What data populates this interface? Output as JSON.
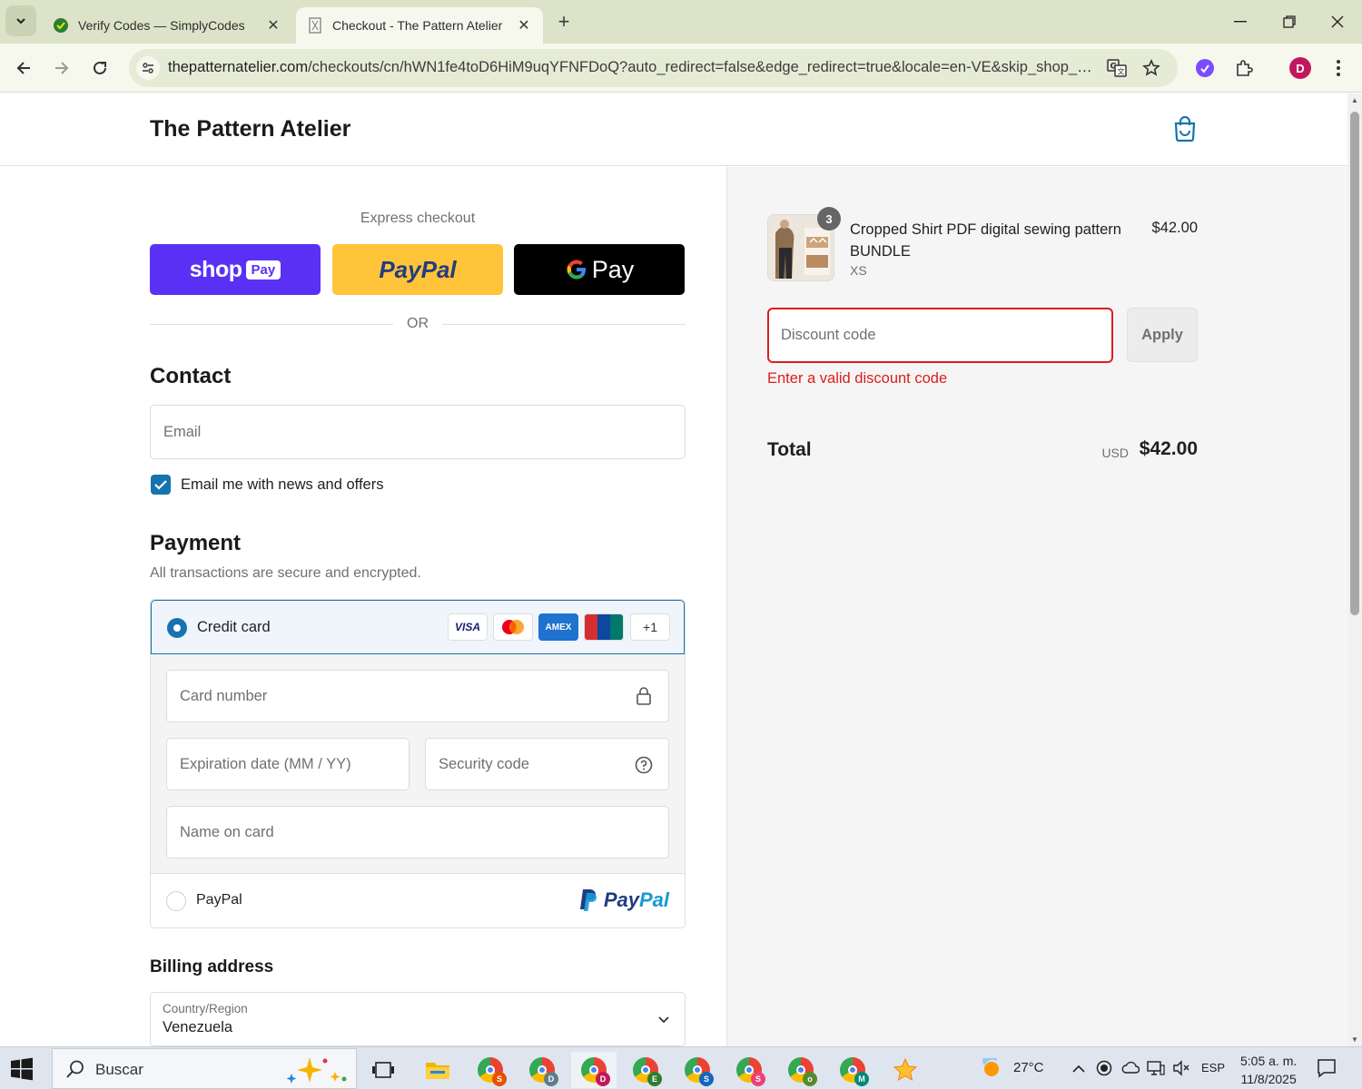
{
  "browser": {
    "tabs": [
      {
        "title": "Verify Codes — SimplyCodes",
        "active": false
      },
      {
        "title": "Checkout - The Pattern Atelier",
        "active": true
      }
    ],
    "url_host": "thepatternatelier.com",
    "url_path": "/checkouts/cn/hWN1fe4toD6HiM9uqYFNFDoQ?auto_redirect=false&edge_redirect=true&locale=en-VE&skip_shop_p...",
    "profile_initial": "D",
    "icons": [
      "back-icon",
      "forward-icon",
      "reload-icon",
      "site-settings-icon",
      "translate-icon",
      "star-icon",
      "extension-icon",
      "puzzle-icon",
      "menu-dots-icon"
    ]
  },
  "store": {
    "name": "The Pattern Atelier"
  },
  "checkout": {
    "express_title": "Express checkout",
    "shop_pay": {
      "word": "shop",
      "badge": "Pay"
    },
    "paypal_label": "PayPal",
    "gpay_label": "Pay",
    "or": "OR",
    "contact_title": "Contact",
    "email_placeholder": "Email",
    "newsletter_label": "Email me with news and offers",
    "newsletter_checked": true,
    "payment_title": "Payment",
    "payment_subtitle": "All transactions are secure and encrypted.",
    "credit_card_label": "Credit card",
    "card_brands": [
      "VISA",
      "Mastercard",
      "AMEX",
      "UnionPay",
      "+1"
    ],
    "card_number_placeholder": "Card number",
    "expiration_placeholder": "Expiration date (MM / YY)",
    "security_placeholder": "Security code",
    "name_placeholder": "Name on card",
    "paypal_option_label": "PayPal",
    "billing_title": "Billing address",
    "country_label": "Country/Region",
    "country_value": "Venezuela"
  },
  "summary": {
    "product_name": "Cropped Shirt PDF digital sewing pattern BUNDLE",
    "variant": "XS",
    "quantity": "3",
    "price": "$42.00",
    "discount_placeholder": "Discount code",
    "apply_label": "Apply",
    "discount_error": "Enter a valid discount code",
    "total_label": "Total",
    "currency": "USD",
    "total": "$42.00"
  },
  "taskbar": {
    "search_text": "Buscar",
    "weather": "27°C",
    "language": "ESP",
    "time": "5:05 a. m.",
    "date": "11/8/2025",
    "chrome_profiles": [
      "S",
      "D",
      "D",
      "E",
      "S",
      "S",
      "o",
      "M"
    ]
  },
  "colors": {
    "shop_pay": "#5a31f4",
    "paypal_yellow": "#ffc439",
    "error": "#dd1d1d",
    "accent": "#1773b0"
  }
}
